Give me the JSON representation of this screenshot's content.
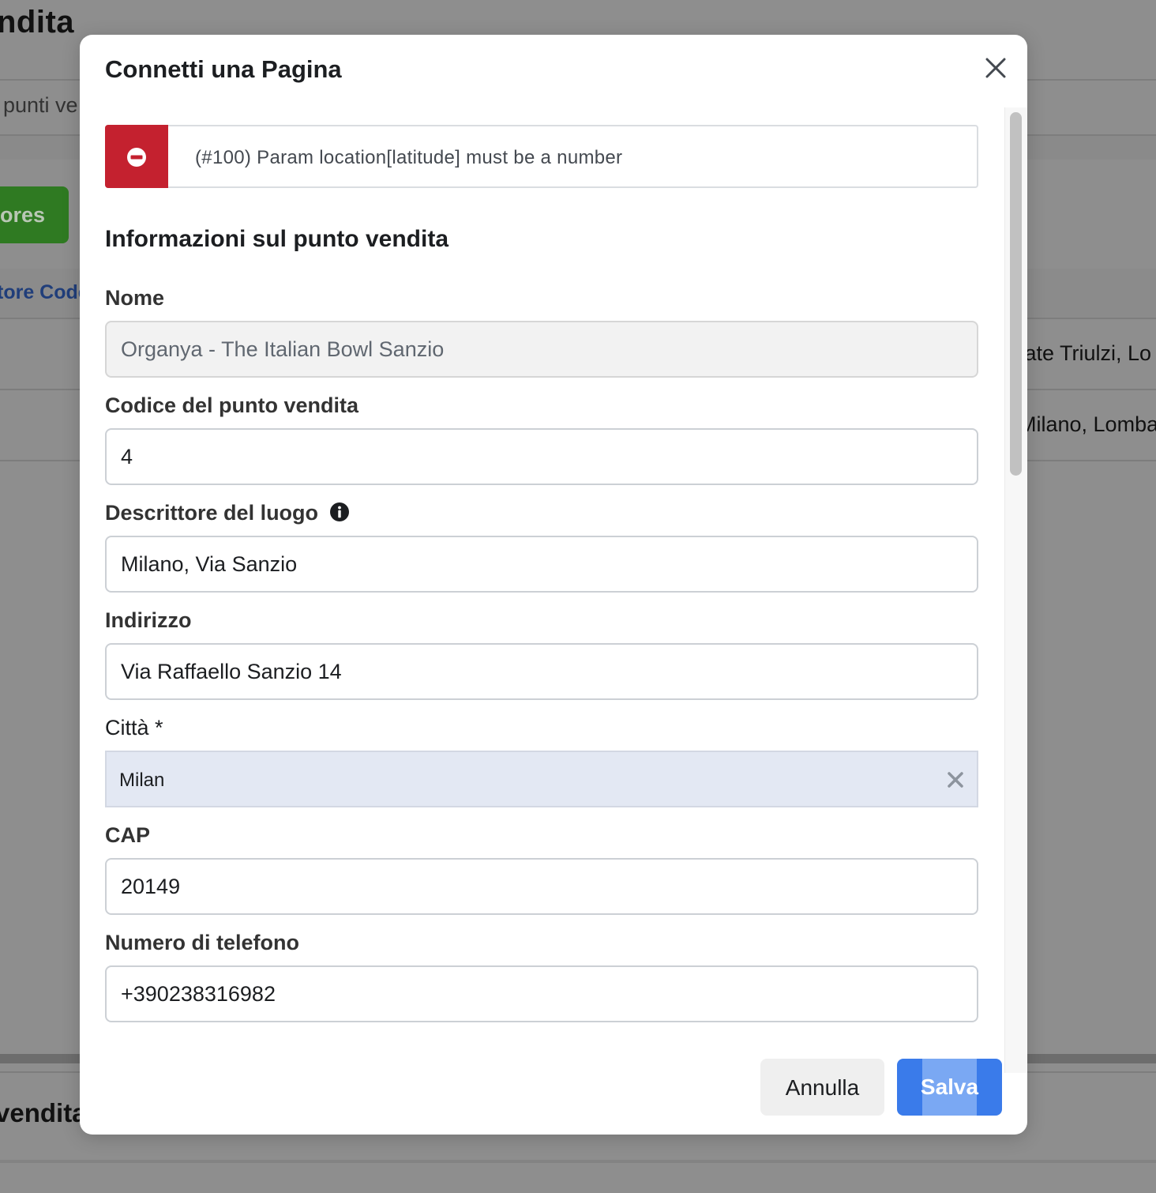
{
  "background": {
    "title_fragment": "ndita",
    "subtitle_fragment": "punti ve",
    "green_button_fragment": "ores",
    "link_fragment": "tore Code",
    "row1_fragment": "cate Triulzi, Lo",
    "row2_fragment": "Milano, Lomba",
    "bottom_title_fragment": "vendita"
  },
  "modal": {
    "title": "Connetti una Pagina",
    "close_icon": "close-icon",
    "error": {
      "icon": "no-entry-icon",
      "message": "(#100) Param location[latitude] must be a number",
      "color": "#c4212f"
    },
    "section_title": "Informazioni sul punto vendita",
    "fields": {
      "name": {
        "label": "Nome",
        "value": "Organya - The Italian Bowl Sanzio",
        "disabled": true
      },
      "store_code": {
        "label": "Codice del punto vendita",
        "value": "4"
      },
      "location_descriptor": {
        "label": "Descrittore del luogo",
        "info_icon": "info-icon",
        "value": "Milano, Via Sanzio"
      },
      "address": {
        "label": "Indirizzo",
        "value": "Via Raffaello Sanzio 14"
      },
      "city": {
        "label": "Città *",
        "value": "Milan",
        "clear_icon": "clear-icon"
      },
      "zip": {
        "label": "CAP",
        "value": "20149"
      },
      "phone": {
        "label": "Numero di telefono",
        "value": "+390238316982"
      }
    },
    "footer": {
      "cancel_label": "Annulla",
      "save_label": "Salva",
      "accent": "#3a7bea"
    }
  }
}
